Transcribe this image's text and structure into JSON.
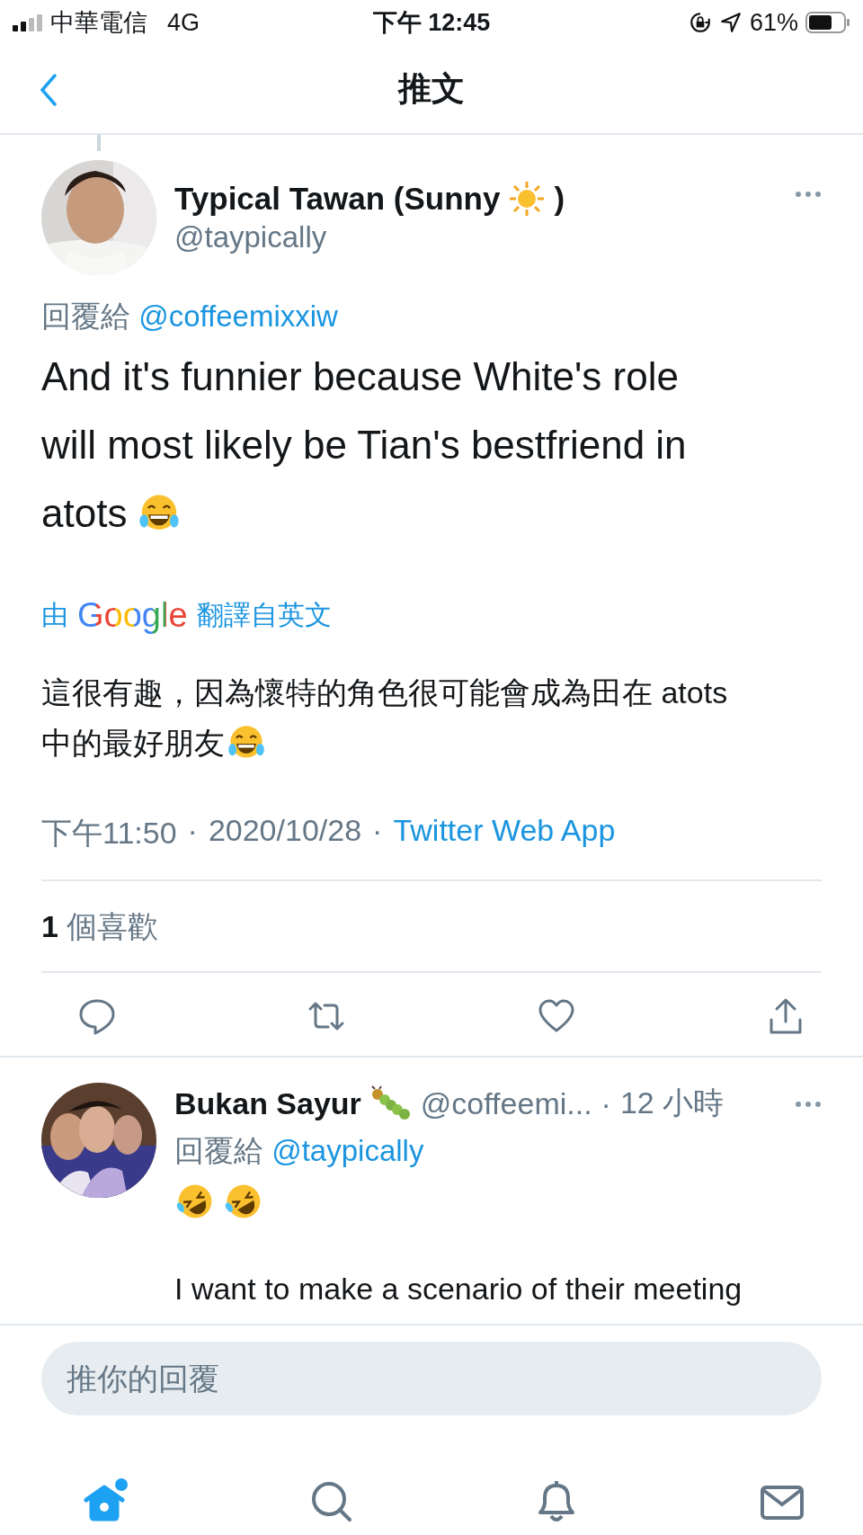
{
  "status_bar": {
    "carrier": "中華電信",
    "network": "4G",
    "time": "下午 12:45",
    "battery": "61%"
  },
  "nav": {
    "title": "推文"
  },
  "tweet": {
    "name": "Typical Tawan (Sunny",
    "name_suffix": ")",
    "handle": "@taypically",
    "reply_label": "回覆給",
    "reply_to": "@coffeemixxiw",
    "text_lines": [
      "And it's funnier because White's role",
      "will most likely be Tian's bestfriend in",
      "atots"
    ],
    "translate": {
      "prefix": "由",
      "brand": "Google",
      "suffix": "翻譯自英文"
    },
    "translation_lines": [
      "這很有趣，因為懷特的角色很可能會成為田在 atots",
      "中的最好朋友"
    ],
    "time": "下午11:50",
    "separator": "·",
    "date": "2020/10/28",
    "source": "Twitter Web App",
    "likes": {
      "count": "1",
      "label": "個喜歡"
    }
  },
  "reply": {
    "name": "Bukan Sayur",
    "handle": "@coffeemi...",
    "separator": "·",
    "age": "12 小時",
    "reply_label": "回覆給",
    "reply_to": "@taypically",
    "text": "I want to make a scenario of their meeting"
  },
  "composer": {
    "placeholder": "推你的回覆"
  },
  "tabs": [
    {
      "kind": "home",
      "selected": true,
      "badge": true
    },
    {
      "kind": "search",
      "selected": false,
      "badge": false
    },
    {
      "kind": "notifications",
      "selected": false,
      "badge": false
    },
    {
      "kind": "messages",
      "selected": false,
      "badge": false
    }
  ]
}
